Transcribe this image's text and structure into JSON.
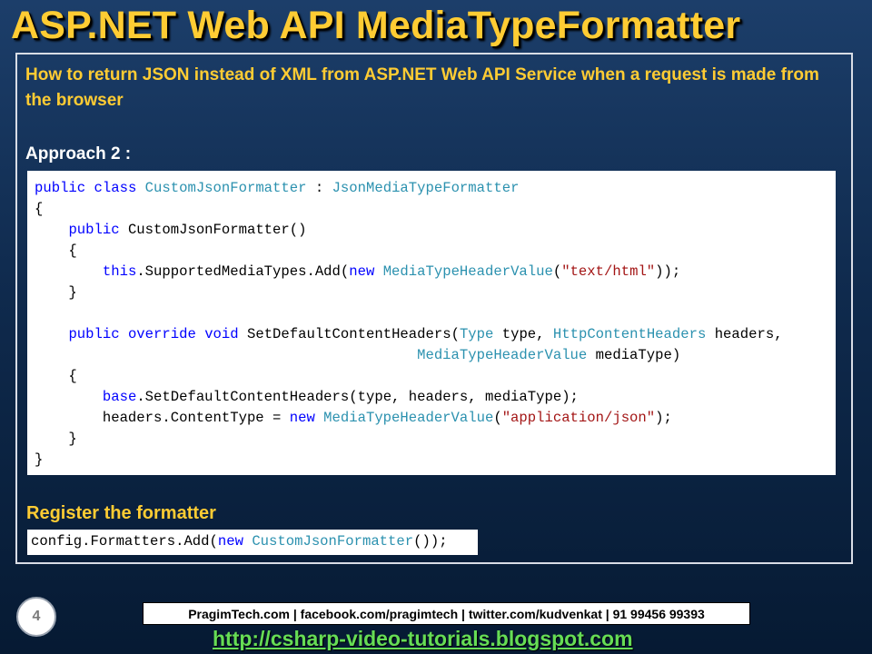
{
  "slide": {
    "title": "ASP.NET Web API MediaTypeFormatter",
    "intro": "How to return JSON instead of XML from ASP.NET Web API Service when a request is made from the browser",
    "approach_heading": "Approach 2 :",
    "register_heading": "Register the formatter",
    "page_number": "4"
  },
  "code_tokens": {
    "kw_public": "public",
    "kw_class": "class",
    "kw_this": "this",
    "kw_new": "new",
    "kw_override": "override",
    "kw_void": "void",
    "kw_base": "base",
    "ty_custom": "CustomJsonFormatter",
    "ty_json": "JsonMediaTypeFormatter",
    "ty_mthv": "MediaTypeHeaderValue",
    "ty_type": "Type",
    "ty_hch": "HttpContentHeaders",
    "str_html": "\"text/html\"",
    "str_json": "\"application/json\""
  },
  "register_tokens": {
    "prefix": "config.Formatters.Add(",
    "kw_new": "new",
    "type": "CustomJsonFormatter",
    "suffix": "());"
  },
  "footer": {
    "contacts": "PragimTech.com | facebook.com/pragimtech  | twitter.com/kudvenkat  | 91 99456 99393",
    "url": "http://csharp-video-tutorials.blogspot.com"
  },
  "colors": {
    "title": "#ffcc33",
    "keyword": "#0000ff",
    "type": "#2b91af",
    "string": "#a31515",
    "url": "#66dd55"
  }
}
